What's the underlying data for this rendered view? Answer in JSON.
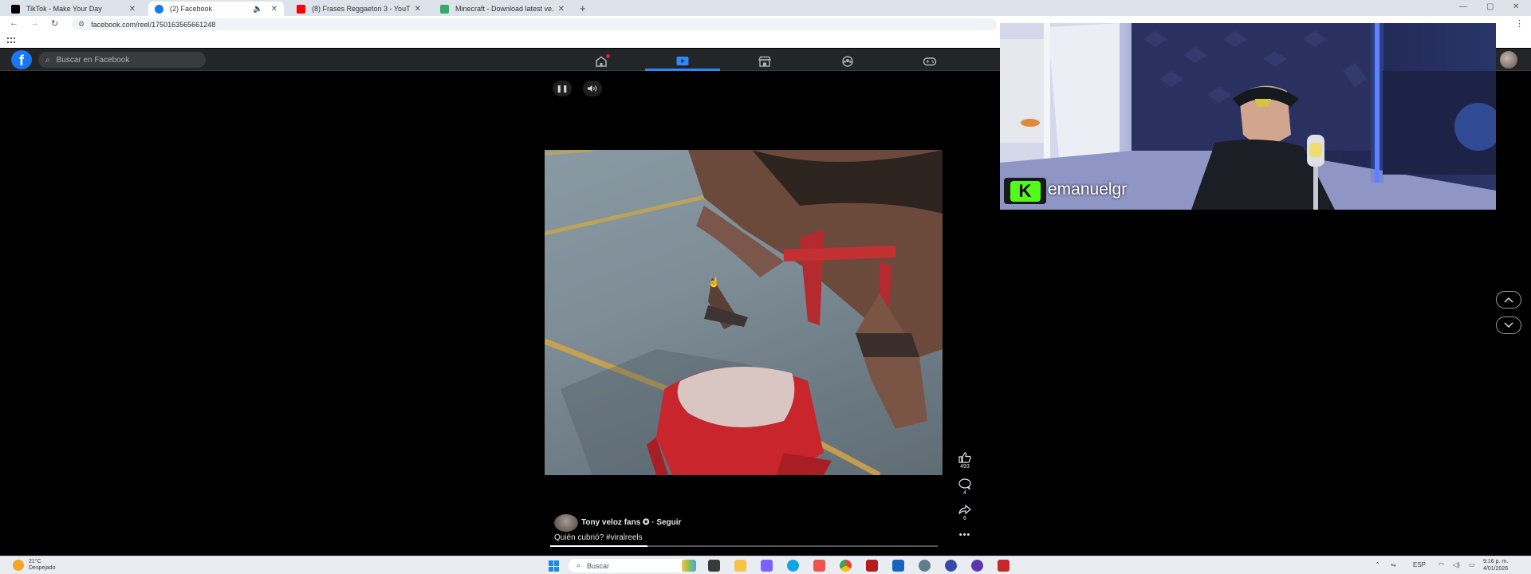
{
  "browser": {
    "tabs": [
      {
        "label": "TikTok - Make Your Day",
        "icon": "tiktok-icon",
        "color": "#000000"
      },
      {
        "label": "(2) Facebook",
        "icon": "facebook-icon",
        "color": "#1877f2",
        "active": true
      },
      {
        "label": "(8) Frases Reggaeton 3 - YouT...",
        "icon": "youtube-icon",
        "color": "#ff0000"
      },
      {
        "label": "Minecraft - Download latest ve...",
        "icon": "minecraft-icon",
        "color": "#3aa76d"
      }
    ],
    "url": "facebook.com/reel/1750163565661248"
  },
  "facebook": {
    "search_placeholder": "Buscar en Facebook",
    "nav": [
      "home-icon",
      "video-icon",
      "marketplace-icon",
      "groups-icon",
      "gaming-icon"
    ],
    "accent": "#2d88ff"
  },
  "reel": {
    "author": "Tony veloz fans ✪ · Seguir",
    "caption": "Quién cubrió?  #viralreels",
    "likes": "493",
    "comments": "4",
    "shares": "6",
    "progress": 0.25
  },
  "stream_overlay": {
    "platform": "kick",
    "badge_letter": "K",
    "username": "emanuelgr",
    "brand_color": "#53fc18"
  },
  "taskbar": {
    "temperature": "21°C",
    "weather": "Despejado",
    "search": "Buscar",
    "language": "ESP",
    "time": "9:16 p. m.",
    "date": "4/01/2026"
  }
}
